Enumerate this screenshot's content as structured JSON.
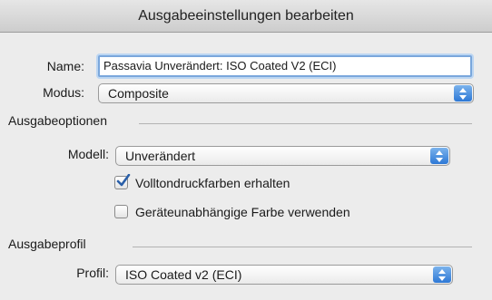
{
  "window": {
    "title": "Ausgabeeinstellungen bearbeiten"
  },
  "name_field": {
    "label": "Name:",
    "value": "Passavia Unverändert: ISO Coated V2 (ECI)"
  },
  "modus": {
    "label": "Modus:",
    "value": "Composite"
  },
  "ausgabeoptionen": {
    "heading": "Ausgabeoptionen",
    "modell": {
      "label": "Modell:",
      "value": "Unverändert"
    },
    "volltondruckfarben": {
      "label": "Volltondruckfarben erhalten",
      "checked": true
    },
    "geraeteunabhaengig": {
      "label": "Geräteunabhängige Farbe verwenden",
      "checked": false
    }
  },
  "ausgabeprofil": {
    "heading": "Ausgabeprofil",
    "profil": {
      "label": "Profil:",
      "value": "ISO Coated v2 (ECI)"
    }
  },
  "colors": {
    "accent": "#2d78d6",
    "focus_ring": "#7aa7dc",
    "check": "#2a5fa8"
  },
  "icons": {
    "popup_arrows": "up-down-arrows-icon",
    "checkmark": "checkmark-icon"
  }
}
